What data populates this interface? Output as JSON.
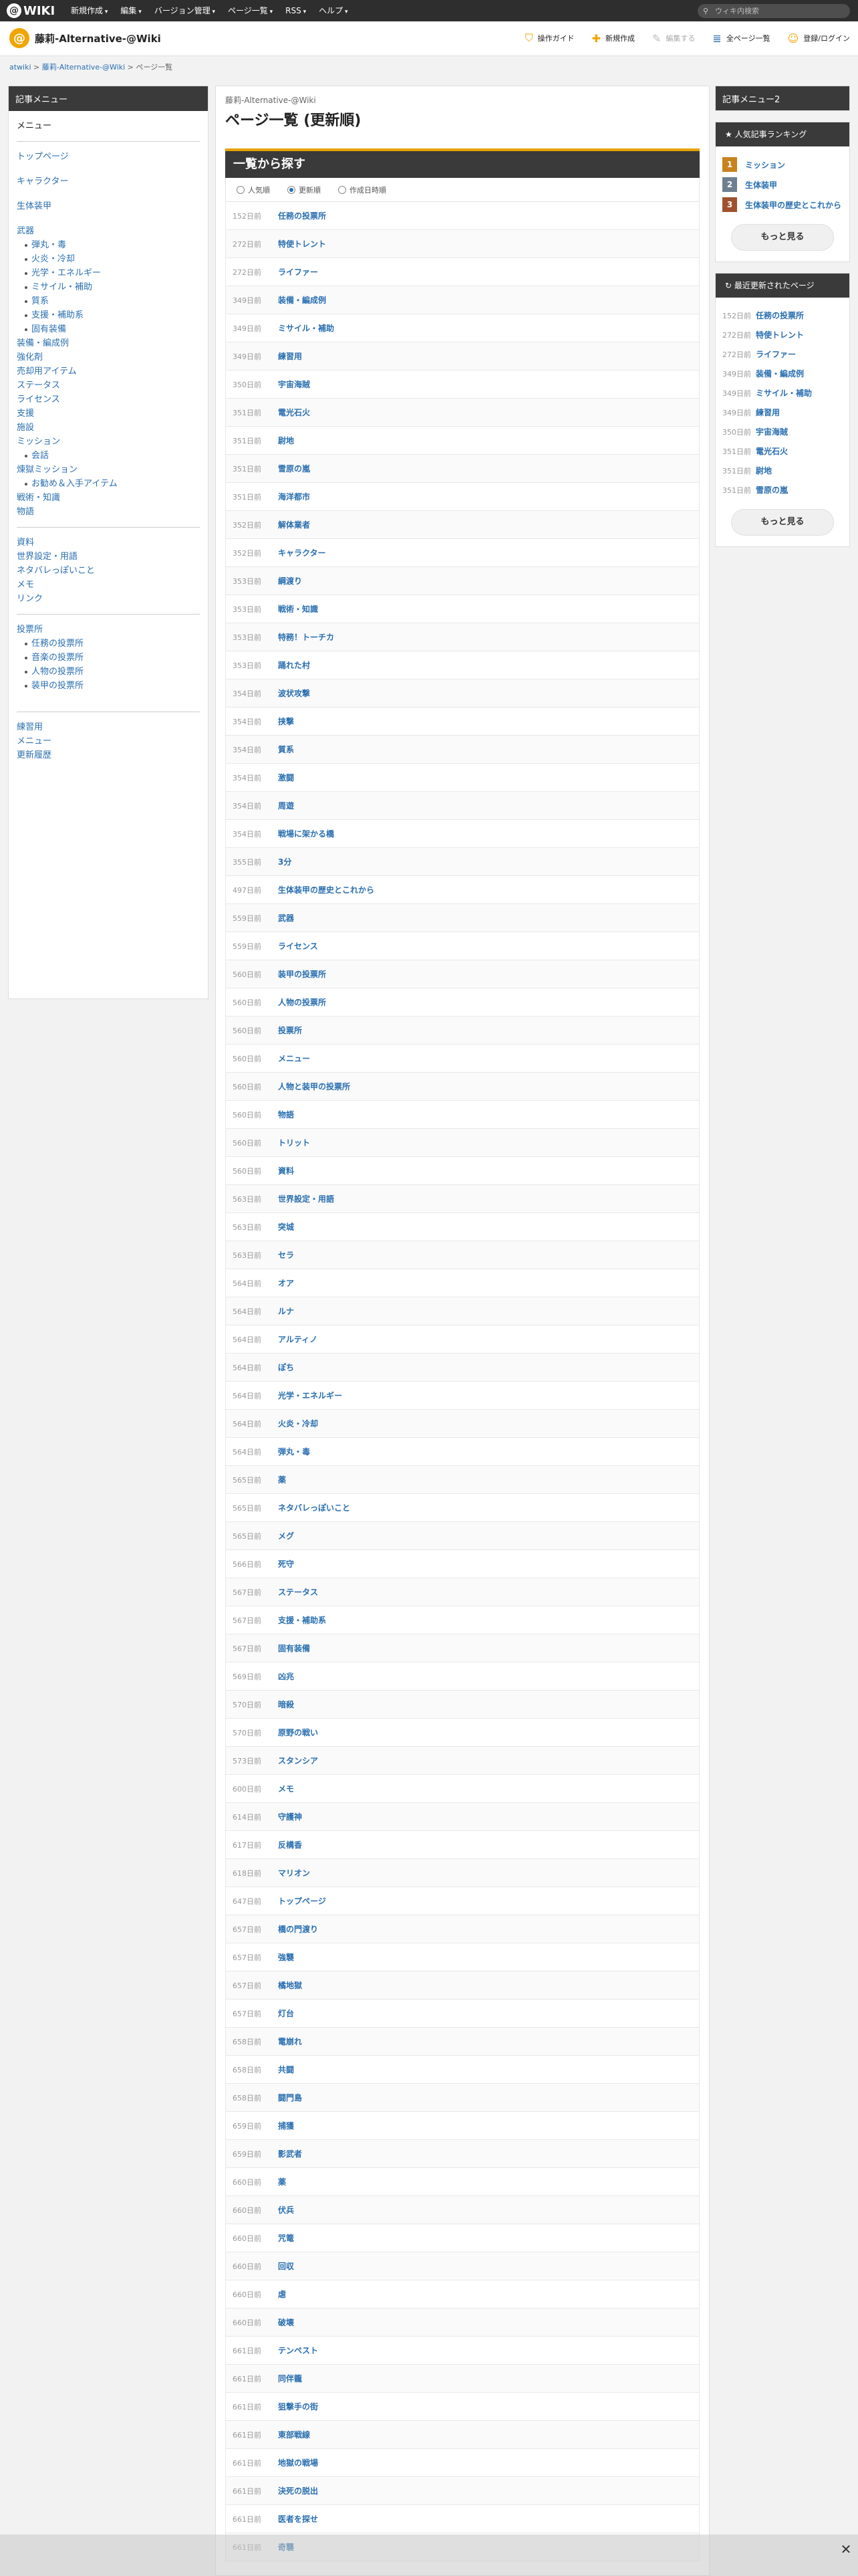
{
  "topbar": {
    "logo": "WIKI",
    "nav": [
      "新規作成",
      "編集",
      "バージョン管理",
      "ページ一覧",
      "RSS",
      "ヘルプ"
    ],
    "search_placeholder": "ウィキ内検索"
  },
  "header": {
    "site_name": "藤莉-Alternative-@Wiki",
    "tools": [
      {
        "label": "操作ガイド",
        "icon": "guide-icon"
      },
      {
        "label": "新規作成",
        "icon": "plus-icon"
      },
      {
        "label": "編集する",
        "icon": "pencil-icon"
      },
      {
        "label": "全ページ一覧",
        "icon": "page-icon"
      },
      {
        "label": "登録/ログイン",
        "icon": "user-icon"
      }
    ]
  },
  "breadcrumb": {
    "root": "atwiki",
    "site": "藤莉-Alternative-@Wiki",
    "current": "ページ一覧"
  },
  "sidebar": {
    "title": "記事メニュー",
    "items": [
      {
        "label": "メニュー",
        "type": "plain"
      },
      {
        "type": "hr"
      },
      {
        "label": "トップページ",
        "type": "link"
      },
      {
        "type": "gap"
      },
      {
        "label": "キャラクター",
        "type": "link"
      },
      {
        "type": "gap"
      },
      {
        "label": "生体装甲",
        "type": "link"
      },
      {
        "type": "gap"
      },
      {
        "label": "武器",
        "type": "link"
      },
      {
        "label": "弾丸・毒",
        "type": "sub"
      },
      {
        "label": "火炎・冷却",
        "type": "sub"
      },
      {
        "label": "光学・エネルギー",
        "type": "sub"
      },
      {
        "label": "ミサイル・補助",
        "type": "sub"
      },
      {
        "label": "質系",
        "type": "sub"
      },
      {
        "label": "支援・補助系",
        "type": "sub"
      },
      {
        "label": "固有装備",
        "type": "sub"
      },
      {
        "label": "装備・編成例",
        "type": "link"
      },
      {
        "label": "強化剤",
        "type": "link"
      },
      {
        "label": "売却用アイテム",
        "type": "link"
      },
      {
        "label": "ステータス",
        "type": "link"
      },
      {
        "label": "ライセンス",
        "type": "link"
      },
      {
        "label": "支援",
        "type": "link"
      },
      {
        "label": "施設",
        "type": "link"
      },
      {
        "label": "ミッション",
        "type": "link"
      },
      {
        "label": "会話",
        "type": "sub"
      },
      {
        "label": "煉獄ミッション",
        "type": "link"
      },
      {
        "label": "お勧め＆入手アイテム",
        "type": "sub"
      },
      {
        "label": "戦術・知識",
        "type": "link"
      },
      {
        "label": "物語",
        "type": "link"
      },
      {
        "type": "hr"
      },
      {
        "label": "資料",
        "type": "link"
      },
      {
        "label": "世界設定・用語",
        "type": "link"
      },
      {
        "label": "ネタバレっぽいこと",
        "type": "link"
      },
      {
        "label": "メモ",
        "type": "link"
      },
      {
        "label": "リンク",
        "type": "link"
      },
      {
        "type": "hr"
      },
      {
        "label": "投票所",
        "type": "link"
      },
      {
        "label": "任務の投票所",
        "type": "sub"
      },
      {
        "label": "音楽の投票所",
        "type": "sub"
      },
      {
        "label": "人物の投票所",
        "type": "sub"
      },
      {
        "label": "装甲の投票所",
        "type": "sub"
      },
      {
        "type": "gap"
      },
      {
        "type": "hr"
      },
      {
        "label": "練習用",
        "type": "link"
      },
      {
        "label": "メニュー",
        "type": "link"
      },
      {
        "label": "更新履歴",
        "type": "link"
      }
    ]
  },
  "main": {
    "wiki_name": "藤莉-Alternative-@Wiki",
    "title": "ページ一覧 (更新順)",
    "section": "一覧から探す",
    "sort_options": [
      "人気順",
      "更新順",
      "作成日時順"
    ],
    "sort_selected": 1,
    "pages": [
      [
        "152日前",
        "任務の投票所"
      ],
      [
        "272日前",
        "特使トレント"
      ],
      [
        "272日前",
        "ライファー"
      ],
      [
        "349日前",
        "装備・編成例"
      ],
      [
        "349日前",
        "ミサイル・補助"
      ],
      [
        "349日前",
        "練習用"
      ],
      [
        "350日前",
        "宇宙海賊"
      ],
      [
        "351日前",
        "電光石火"
      ],
      [
        "351日前",
        "尉地"
      ],
      [
        "351日前",
        "雪原の嵐"
      ],
      [
        "351日前",
        "海洋都市"
      ],
      [
        "352日前",
        "解体業者"
      ],
      [
        "352日前",
        "キャラクター"
      ],
      [
        "353日前",
        "綱渡り"
      ],
      [
        "353日前",
        "戦術・知識"
      ],
      [
        "353日前",
        "特務！トーチカ"
      ],
      [
        "353日前",
        "踊れた村"
      ],
      [
        "354日前",
        "波状攻撃"
      ],
      [
        "354日前",
        "挟撃"
      ],
      [
        "354日前",
        "質系"
      ],
      [
        "354日前",
        "激闘"
      ],
      [
        "354日前",
        "周遊"
      ],
      [
        "354日前",
        "戦場に架かる橋"
      ],
      [
        "355日前",
        "3分"
      ],
      [
        "497日前",
        "生体装甲の歴史とこれから"
      ],
      [
        "559日前",
        "武器"
      ],
      [
        "559日前",
        "ライセンス"
      ],
      [
        "560日前",
        "装甲の投票所"
      ],
      [
        "560日前",
        "人物の投票所"
      ],
      [
        "560日前",
        "投票所"
      ],
      [
        "560日前",
        "メニュー"
      ],
      [
        "560日前",
        "人物と装甲の投票所"
      ],
      [
        "560日前",
        "物語"
      ],
      [
        "560日前",
        "トリット"
      ],
      [
        "560日前",
        "資料"
      ],
      [
        "563日前",
        "世界設定・用語"
      ],
      [
        "563日前",
        "突城"
      ],
      [
        "563日前",
        "セラ"
      ],
      [
        "564日前",
        "オア"
      ],
      [
        "564日前",
        "ルナ"
      ],
      [
        "564日前",
        "アルティノ"
      ],
      [
        "564日前",
        "ぽち"
      ],
      [
        "564日前",
        "光学・エネルギー"
      ],
      [
        "564日前",
        "火炎・冷却"
      ],
      [
        "564日前",
        "弾丸・毒"
      ],
      [
        "565日前",
        "薬"
      ],
      [
        "565日前",
        "ネタバレっぽいこと"
      ],
      [
        "565日前",
        "メグ"
      ],
      [
        "566日前",
        "死守"
      ],
      [
        "567日前",
        "ステータス"
      ],
      [
        "567日前",
        "支援・補助系"
      ],
      [
        "567日前",
        "固有装備"
      ],
      [
        "569日前",
        "凶兆"
      ],
      [
        "570日前",
        "暗殺"
      ],
      [
        "570日前",
        "原野の戦い"
      ],
      [
        "573日前",
        "スタンシア"
      ],
      [
        "600日前",
        "メモ"
      ],
      [
        "614日前",
        "守護神"
      ],
      [
        "617日前",
        "反構香"
      ],
      [
        "618日前",
        "マリオン"
      ],
      [
        "647日前",
        "トップページ"
      ],
      [
        "657日前",
        "橋の門渡り"
      ],
      [
        "657日前",
        "強襲"
      ],
      [
        "657日前",
        "橘地獄"
      ],
      [
        "657日前",
        "灯台"
      ],
      [
        "658日前",
        "電崩れ"
      ],
      [
        "658日前",
        "共闘"
      ],
      [
        "658日前",
        "闘門島"
      ],
      [
        "659日前",
        "捕獲"
      ],
      [
        "659日前",
        "影武者"
      ],
      [
        "660日前",
        "薬"
      ],
      [
        "660日前",
        "伏兵"
      ],
      [
        "660日前",
        "咒篭"
      ],
      [
        "660日前",
        "回収"
      ],
      [
        "660日前",
        "虐"
      ],
      [
        "660日前",
        "破壊"
      ],
      [
        "661日前",
        "テンペスト"
      ],
      [
        "661日前",
        "同伴籠"
      ],
      [
        "661日前",
        "狙撃手の街"
      ],
      [
        "661日前",
        "東部戦線"
      ],
      [
        "661日前",
        "地獄の戦場"
      ],
      [
        "661日前",
        "決死の脱出"
      ],
      [
        "661日前",
        "医者を探せ"
      ],
      [
        "661日前",
        "奇襲"
      ]
    ]
  },
  "right": {
    "box1_title": "記事メニュー2",
    "ranking_title": "人気記事ランキング",
    "ranking": [
      {
        "n": "1",
        "label": "ミッション",
        "color": "#c8821e"
      },
      {
        "n": "2",
        "label": "生体装甲",
        "color": "#6e7f8f"
      },
      {
        "n": "3",
        "label": "生体装甲の歴史とこれから",
        "color": "#a0522d"
      }
    ],
    "more": "もっと見る",
    "recent_title": "最近更新されたページ",
    "recent": [
      [
        "152日前",
        "任務の投票所"
      ],
      [
        "272日前",
        "特使トレント"
      ],
      [
        "272日前",
        "ライファー"
      ],
      [
        "349日前",
        "装備・編成例"
      ],
      [
        "349日前",
        "ミサイル・補助"
      ],
      [
        "349日前",
        "練習用"
      ],
      [
        "350日前",
        "宇宙海賊"
      ],
      [
        "351日前",
        "電光石火"
      ],
      [
        "351日前",
        "尉地"
      ],
      [
        "351日前",
        "雪原の嵐"
      ]
    ],
    "more2": "もっと見る"
  }
}
